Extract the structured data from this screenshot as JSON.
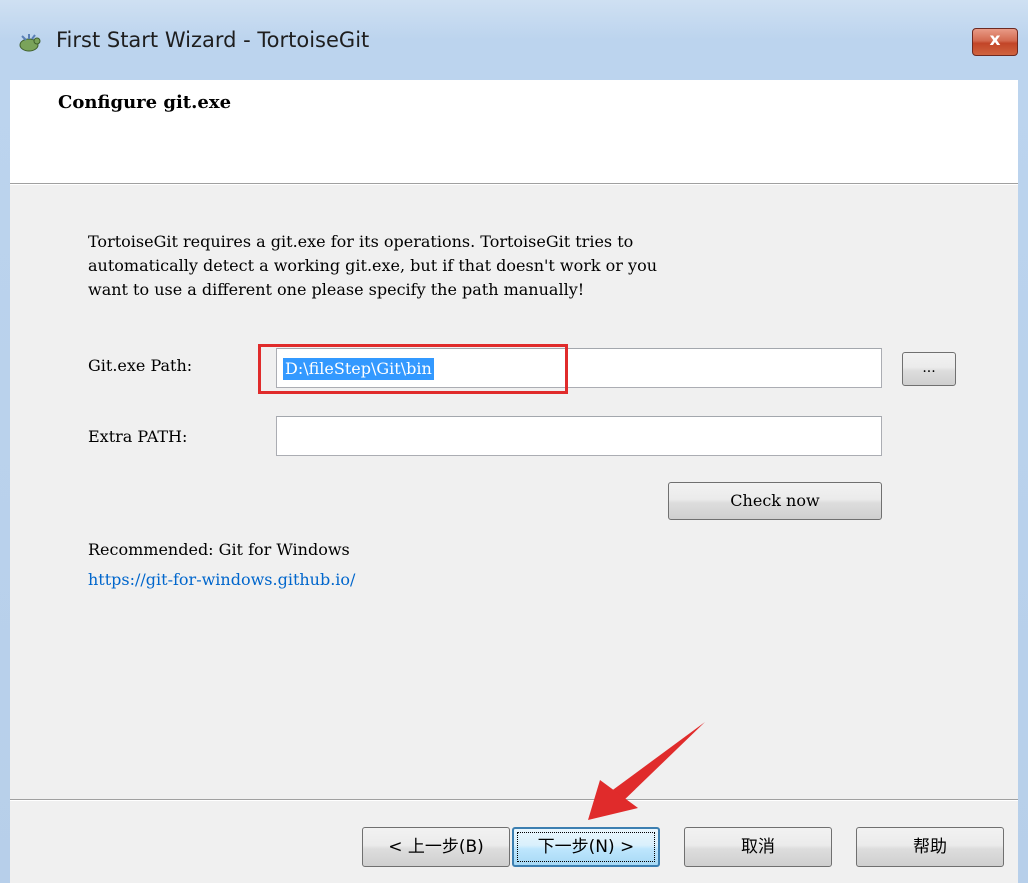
{
  "window": {
    "title": "First Start Wizard - TortoiseGit",
    "close_label": "x"
  },
  "header": {
    "title": "Configure git.exe"
  },
  "main": {
    "description": "TortoiseGit requires a git.exe for its operations. TortoiseGit tries to\nautomatically detect a working git.exe, but if that doesn't work or you\nwant to use a different one please specify the path manually!",
    "git_path_label": "Git.exe Path:",
    "git_path_value": "D:\\fileStep\\Git\\bin",
    "browse_label": "...",
    "extra_path_label": "Extra PATH:",
    "extra_path_value": "",
    "check_now_label": "Check now",
    "recommended_text": "Recommended: Git for Windows",
    "link_text": "https://git-for-windows.github.io/"
  },
  "footer": {
    "back_label": "< 上一步(B)",
    "next_label": "下一步(N) >",
    "cancel_label": "取消",
    "help_label": "帮助"
  },
  "colors": {
    "annotation": "#e02b2b",
    "link": "#0066cc",
    "selection": "#3399ff"
  }
}
